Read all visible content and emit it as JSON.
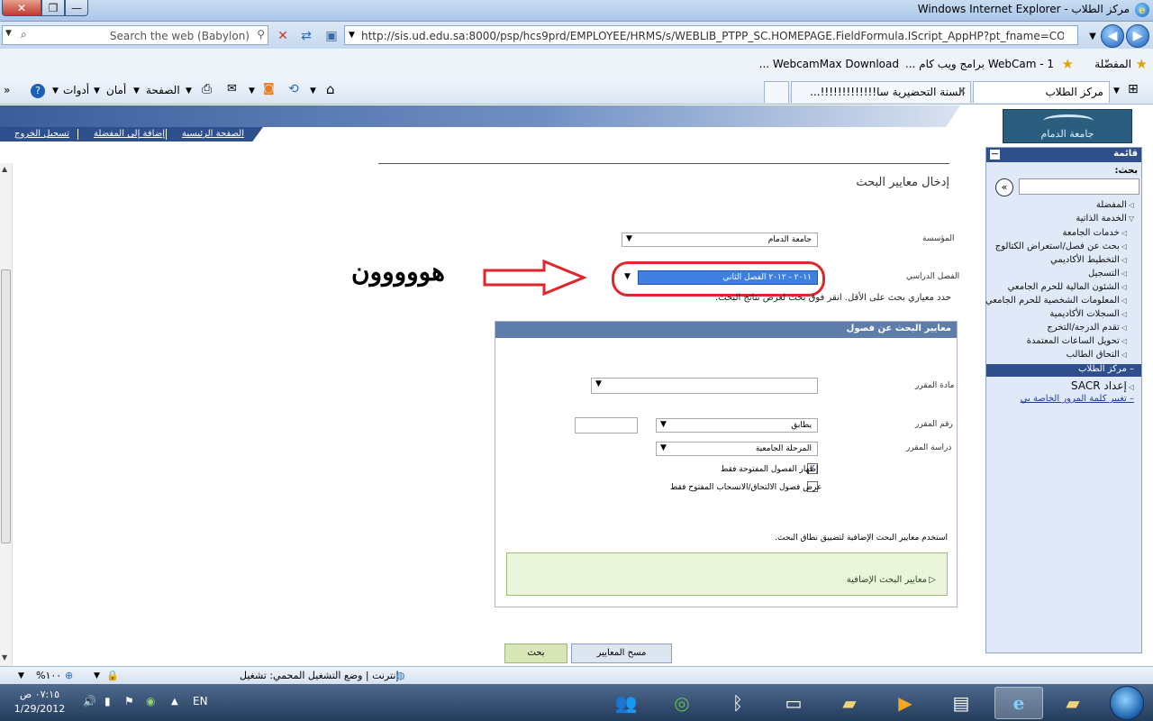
{
  "window": {
    "title": "مركز الطلاب - Windows Internet Explorer",
    "close_glyph": "✕",
    "max_glyph": "❐",
    "min_glyph": "—"
  },
  "addressbar": {
    "search_placeholder": "Search the web (Babylon)",
    "url": "http://sis.ud.edu.sa:8000/psp/hcs9prd/EMPLOYEE/HRMS/s/WEBLIB_PTPP_SC.HOMEPAGE.FieldFormula.IScript_AppHP?pt_fname=CO_EMPLOYEE_"
  },
  "favorites": {
    "label": "المفضّلة",
    "items": [
      "WebCam - 1 برامج ويب كام ...",
      "WebcamMax Download ..."
    ]
  },
  "commandbar": {
    "tools": "أدوات",
    "safety": "أمان",
    "page": "الصفحة",
    "help_glyph": "?",
    "chevron": "»"
  },
  "tabs": [
    {
      "label": "مركز الطلاب",
      "active": true
    },
    {
      "label": "السنة التحضيرية سا!!!!!!!!!!!!!...",
      "active": false
    }
  ],
  "page_links": {
    "home": "الصفحة الرئيسية",
    "add_fav": "إضافة إلى المفضلة",
    "logout": "تسجيل الخروج"
  },
  "logo_text": "جامعة الدمام",
  "content": {
    "title": "إدخال معايير البحث",
    "institution_label": "المؤسسة",
    "institution_value": "جامعة الدمام",
    "term_label": "الفصل الدراسي",
    "term_value": "٢٠١١ - ٢٠١٢ الفصل الثاني",
    "annotation": "هووووون",
    "hint": "حدد معياري بحث على الأقل. انقر فوق بحث لعرض نتائج البحث."
  },
  "criteria_panel": {
    "header": "معايير البحث عن فصول",
    "subject_label": "مادة المقرر",
    "course_number_label": "رقم المقرر",
    "course_number_operator": "يطابق",
    "career_label": "دراسة المقرر",
    "career_value": "المرحلة الجامعية",
    "open_only_label": "إظهار الفصول المفتوحة فقط",
    "open_only_checked": true,
    "enroll_label": "عرض فصول الالتحاق/الانسحاب المفتوح فقط",
    "enroll_checked": false,
    "additional_note": "استخدم معايير البحث الإضافية لتضييق نطاق البحث.",
    "additional_link": "معايير البحث الإضافية"
  },
  "buttons": {
    "search": "بحث",
    "clear": "مسح المعايير"
  },
  "menu": {
    "header": "قائمة",
    "search_label": "بحث:",
    "go_glyph": "«",
    "items": [
      {
        "label": "المفضلة",
        "indent": 0,
        "tri": "◁"
      },
      {
        "label": "الخدمة الذاتية",
        "indent": 0,
        "tri": "▽"
      },
      {
        "label": "خدمات الجامعة",
        "indent": 1,
        "tri": "◁"
      },
      {
        "label": "بحث عن فصل/استعراض الكتالوج",
        "indent": 1,
        "tri": "◁"
      },
      {
        "label": "التخطيط الأكاديمي",
        "indent": 1,
        "tri": "◁"
      },
      {
        "label": "التسجيل",
        "indent": 1,
        "tri": "◁"
      },
      {
        "label": "الشئون المالية للحرم الجامعي",
        "indent": 1,
        "tri": "◁"
      },
      {
        "label": "المعلومات الشخصية للحرم الجامعي",
        "indent": 1,
        "tri": "◁"
      },
      {
        "label": "السجلات الأكاديمية",
        "indent": 1,
        "tri": "◁"
      },
      {
        "label": "تقدم الدرجة/التخرج",
        "indent": 1,
        "tri": "◁"
      },
      {
        "label": "تحويل الساعات المعتمدة",
        "indent": 1,
        "tri": "◁"
      },
      {
        "label": "التحاق الطالب",
        "indent": 1,
        "tri": "◁"
      }
    ],
    "selected": "مركز الطلاب",
    "sacr": "إعداد SACR",
    "change_password": "تغيير كلمة المرور الخاصة بي"
  },
  "status": {
    "text": "إنترنت | وضع التشغيل المحمي: تشغيل",
    "zoom": "١٠٠%"
  },
  "taskbar": {
    "time": "٠٧:١٥ ص",
    "date": "1/29/2012",
    "lang": "EN"
  },
  "colors": {
    "accent": "#2e4f8c",
    "highlight": "#3e7fe0",
    "annotation_red": "#e0262b"
  }
}
